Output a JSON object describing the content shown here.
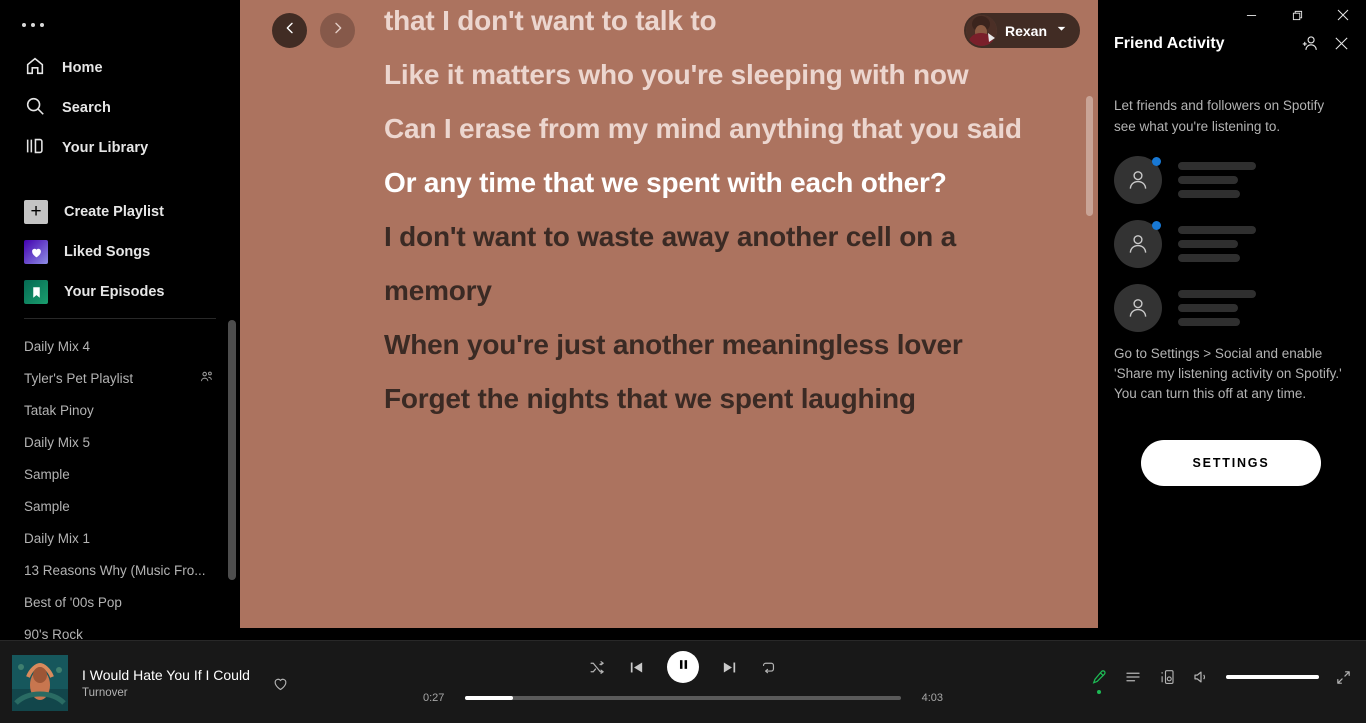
{
  "sidebar": {
    "more_icon": "more-horizontal-icon",
    "nav": [
      {
        "label": "Home",
        "icon": "home-icon"
      },
      {
        "label": "Search",
        "icon": "search-icon"
      },
      {
        "label": "Your Library",
        "icon": "library-icon"
      }
    ],
    "actions": [
      {
        "label": "Create Playlist",
        "icon": "plus-square-icon"
      },
      {
        "label": "Liked Songs",
        "icon": "heart-square-icon"
      },
      {
        "label": "Your Episodes",
        "icon": "bookmark-square-icon"
      }
    ],
    "playlists": [
      {
        "name": "Daily Mix 4",
        "collaborative": false
      },
      {
        "name": "Tyler's Pet Playlist",
        "collaborative": true
      },
      {
        "name": "Tatak Pinoy",
        "collaborative": false
      },
      {
        "name": "Daily Mix 5",
        "collaborative": false
      },
      {
        "name": "Sample",
        "collaborative": false
      },
      {
        "name": "Sample",
        "collaborative": false
      },
      {
        "name": "Daily Mix 1",
        "collaborative": false
      },
      {
        "name": "13 Reasons Why (Music Fro...",
        "collaborative": false
      },
      {
        "name": "Best of '00s Pop",
        "collaborative": false
      },
      {
        "name": "90's Rock",
        "collaborative": false
      }
    ]
  },
  "topbar": {
    "back_icon": "chevron-left-icon",
    "forward_icon": "chevron-right-icon",
    "user_name": "Rexan",
    "user_avatar": "avatar-photo",
    "user_chevron": "chevron-down-icon"
  },
  "lyrics": {
    "lines": [
      {
        "text": "that I don't want to talk to",
        "state": "past"
      },
      {
        "text": "Like it matters who you're sleeping with now",
        "state": "past"
      },
      {
        "text": "Can I erase from my mind anything that you said",
        "state": "past"
      },
      {
        "text": "Or any time that we spent with each other?",
        "state": "active"
      },
      {
        "text": "I don't want to waste away another cell on a memory",
        "state": "next"
      },
      {
        "text": "When you're just another meaningless lover",
        "state": "next"
      },
      {
        "text": "Forget the nights that we spent laughing",
        "state": "next"
      }
    ],
    "background_color": "#ac735f",
    "past_color": "#ecd6cf",
    "active_color": "#ffffff",
    "upcoming_color": "#3a2a24"
  },
  "window_controls": {
    "minimize": "minimize-icon",
    "maximize": "restore-icon",
    "close": "close-icon"
  },
  "friend_activity": {
    "title": "Friend Activity",
    "add_friend_icon": "add-person-icon",
    "close_icon": "close-icon",
    "blurb": "Let friends and followers on Spotify see what you're listening to.",
    "skeletons": [
      {
        "online": true
      },
      {
        "online": true
      },
      {
        "online": false
      }
    ],
    "note": "Go to Settings > Social and enable 'Share my listening activity on Spotify.' You can turn this off at any time.",
    "settings_button": "SETTINGS",
    "online_dot_color": "#1878d4"
  },
  "player": {
    "track_title": "I Would Hate You If I Could",
    "artist": "Turnover",
    "album_art": "album-cover-thumbnail",
    "like_icon": "heart-outline-icon",
    "shuffle_icon": "shuffle-icon",
    "previous_icon": "skip-previous-icon",
    "play_pause_icon": "pause-icon",
    "next_icon": "skip-next-icon",
    "repeat_icon": "repeat-icon",
    "elapsed": "0:27",
    "duration": "4:03",
    "progress_percent": 11,
    "lyrics_icon": "microphone-icon",
    "queue_icon": "queue-icon",
    "devices_icon": "connect-device-icon",
    "volume_icon": "volume-icon",
    "fullscreen_icon": "fullscreen-icon",
    "volume_percent": 100,
    "lyrics_active_color": "#1db954"
  }
}
